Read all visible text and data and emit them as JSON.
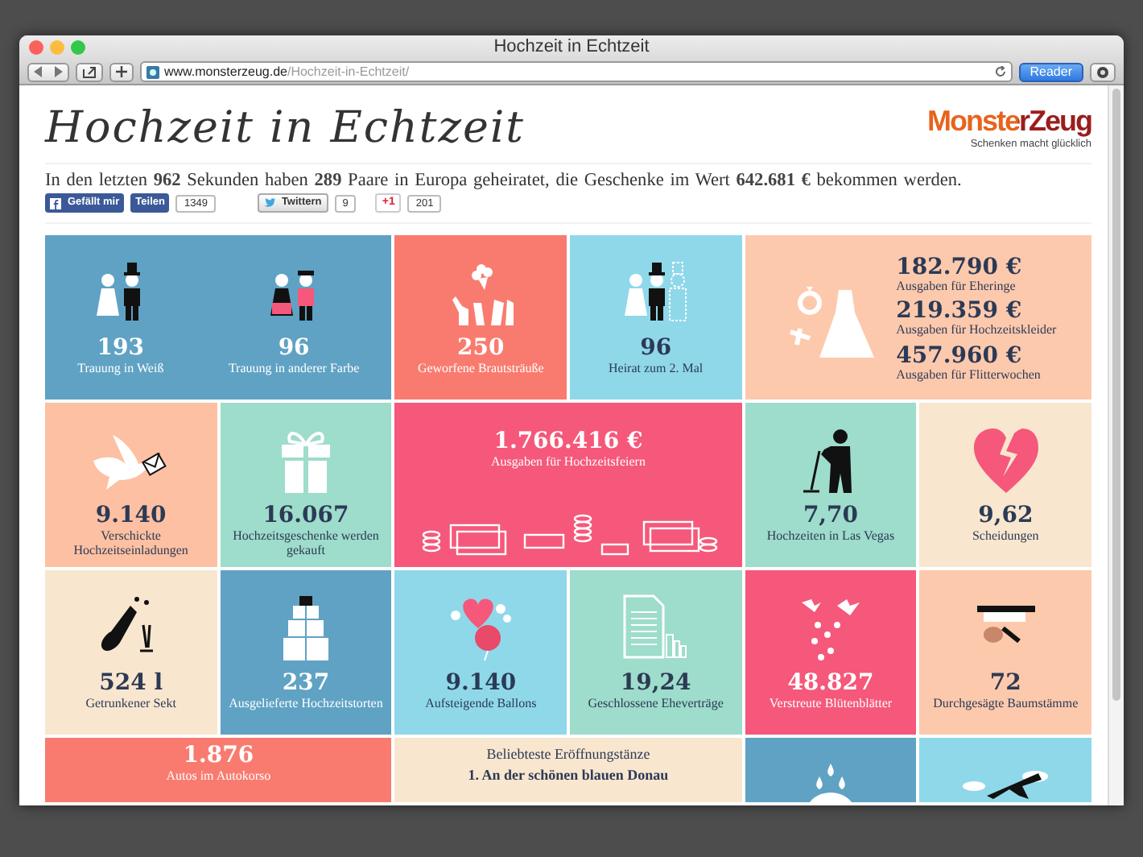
{
  "window": {
    "title": "Hochzeit in Echtzeit"
  },
  "toolbar": {
    "url_domain": "www.monsterzeug.de",
    "url_path": "/Hochzeit-in-Echtzeit/",
    "reader": "Reader"
  },
  "page": {
    "title": "Hochzeit in Echtzeit",
    "logo": {
      "name": "MonsterZeug",
      "tagline": "Schenken macht glücklich"
    },
    "summary": "In den letzten **962** Sekunden haben **289** Paare in Europa geheiratet, die Geschenke im Wert **642.681 €** bekommen werden.",
    "social": {
      "like": "Gefällt mir",
      "share": "Teilen",
      "share_count": "1349",
      "tweet": "Twittern",
      "tweet_count": "9",
      "plus": "+1",
      "plus_count": "201"
    }
  },
  "tiles": [
    {
      "kind": "pair",
      "color": "#5fa2c4",
      "items": [
        {
          "value": "193",
          "label": "Trauung in Weiß"
        },
        {
          "value": "96",
          "label": "Trauung in anderer Farbe"
        }
      ]
    },
    {
      "kind": "stat",
      "color": "#f97b6f",
      "value": "250",
      "label": "Geworfene Brautsträuße"
    },
    {
      "kind": "stat",
      "color": "#8fd8ea",
      "value": "96",
      "label": "Heirat zum 2. Mal"
    },
    {
      "kind": "money",
      "color": "#fdc9ad",
      "lines": [
        {
          "value": "182.790 €",
          "label": "Ausgaben für Eheringe"
        },
        {
          "value": "219.359 €",
          "label": "Ausgaben für Hochzeitskleider"
        },
        {
          "value": "457.960 €",
          "label": "Ausgaben für Flitterwochen"
        }
      ]
    },
    {
      "kind": "stat",
      "color": "#fdc0a2",
      "value": "9.140",
      "label": "Verschickte Hochzeitseinladungen"
    },
    {
      "kind": "stat",
      "color": "#9edccb",
      "value": "16.067",
      "label": "Hochzeitsgeschenke werden gekauft"
    },
    {
      "kind": "party",
      "color": "#f5587a",
      "value": "1.766.416 €",
      "label": "Ausgaben für Hochzeitsfeiern"
    },
    {
      "kind": "stat",
      "color": "#9edccb",
      "value": "7,70",
      "label": "Hochzeiten in Las Vegas"
    },
    {
      "kind": "stat",
      "color": "#f8e6cf",
      "value": "9,62",
      "label": "Scheidungen"
    },
    {
      "kind": "stat",
      "color": "#f8e6cf",
      "value": "524 l",
      "label": "Getrunkener Sekt"
    },
    {
      "kind": "stat",
      "color": "#5fa2c4",
      "value": "237",
      "label": "Ausgelieferte Hochzeitstorten"
    },
    {
      "kind": "stat",
      "color": "#8fd8ea",
      "value": "9.140",
      "label": "Aufsteigende Ballons"
    },
    {
      "kind": "stat",
      "color": "#9edccb",
      "value": "19,24",
      "label": "Geschlossene Eheverträge"
    },
    {
      "kind": "stat",
      "color": "#f5587a",
      "value": "48.827",
      "label": "Verstreute Blütenblätter"
    },
    {
      "kind": "stat",
      "color": "#fdc9ad",
      "value": "72",
      "label": "Durchgesägte Baumstämme"
    },
    {
      "kind": "wide-stat",
      "color": "#f97b6f",
      "value": "1.876",
      "label": "Autos im Autokorso"
    },
    {
      "kind": "dances",
      "color": "#f8e6cf",
      "heading": "Beliebteste Eröffnungstänze",
      "items": [
        "1. An der schönen blauen Donau"
      ]
    },
    {
      "kind": "picture",
      "color": "#5fa2c4"
    },
    {
      "kind": "picture",
      "color": "#8fd8ea"
    }
  ]
}
